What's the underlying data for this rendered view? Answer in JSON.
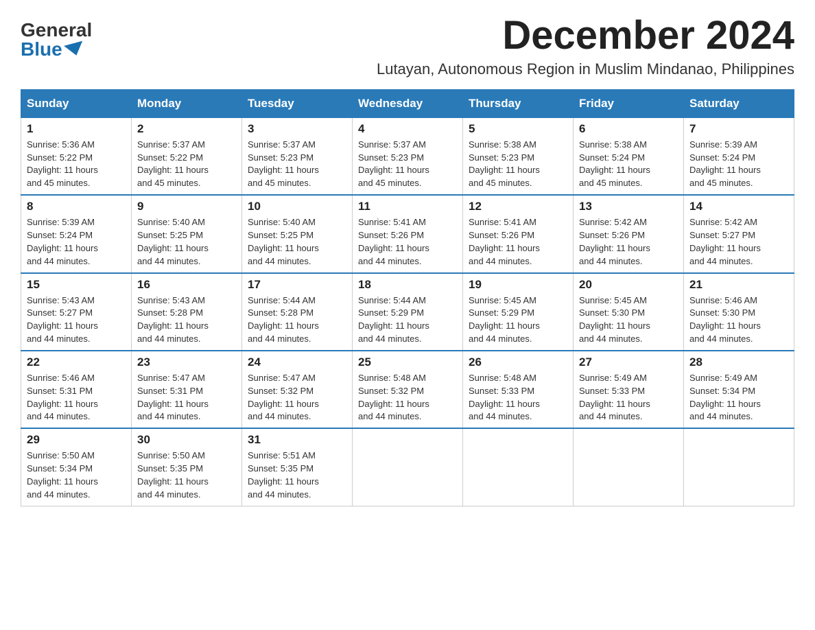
{
  "logo": {
    "general": "General",
    "blue": "Blue"
  },
  "title": "December 2024",
  "subtitle": "Lutayan, Autonomous Region in Muslim Mindanao, Philippines",
  "weekdays": [
    "Sunday",
    "Monday",
    "Tuesday",
    "Wednesday",
    "Thursday",
    "Friday",
    "Saturday"
  ],
  "weeks": [
    [
      {
        "day": "1",
        "sunrise": "5:36 AM",
        "sunset": "5:22 PM",
        "daylight": "11 hours and 45 minutes."
      },
      {
        "day": "2",
        "sunrise": "5:37 AM",
        "sunset": "5:22 PM",
        "daylight": "11 hours and 45 minutes."
      },
      {
        "day": "3",
        "sunrise": "5:37 AM",
        "sunset": "5:23 PM",
        "daylight": "11 hours and 45 minutes."
      },
      {
        "day": "4",
        "sunrise": "5:37 AM",
        "sunset": "5:23 PM",
        "daylight": "11 hours and 45 minutes."
      },
      {
        "day": "5",
        "sunrise": "5:38 AM",
        "sunset": "5:23 PM",
        "daylight": "11 hours and 45 minutes."
      },
      {
        "day": "6",
        "sunrise": "5:38 AM",
        "sunset": "5:24 PM",
        "daylight": "11 hours and 45 minutes."
      },
      {
        "day": "7",
        "sunrise": "5:39 AM",
        "sunset": "5:24 PM",
        "daylight": "11 hours and 45 minutes."
      }
    ],
    [
      {
        "day": "8",
        "sunrise": "5:39 AM",
        "sunset": "5:24 PM",
        "daylight": "11 hours and 44 minutes."
      },
      {
        "day": "9",
        "sunrise": "5:40 AM",
        "sunset": "5:25 PM",
        "daylight": "11 hours and 44 minutes."
      },
      {
        "day": "10",
        "sunrise": "5:40 AM",
        "sunset": "5:25 PM",
        "daylight": "11 hours and 44 minutes."
      },
      {
        "day": "11",
        "sunrise": "5:41 AM",
        "sunset": "5:26 PM",
        "daylight": "11 hours and 44 minutes."
      },
      {
        "day": "12",
        "sunrise": "5:41 AM",
        "sunset": "5:26 PM",
        "daylight": "11 hours and 44 minutes."
      },
      {
        "day": "13",
        "sunrise": "5:42 AM",
        "sunset": "5:26 PM",
        "daylight": "11 hours and 44 minutes."
      },
      {
        "day": "14",
        "sunrise": "5:42 AM",
        "sunset": "5:27 PM",
        "daylight": "11 hours and 44 minutes."
      }
    ],
    [
      {
        "day": "15",
        "sunrise": "5:43 AM",
        "sunset": "5:27 PM",
        "daylight": "11 hours and 44 minutes."
      },
      {
        "day": "16",
        "sunrise": "5:43 AM",
        "sunset": "5:28 PM",
        "daylight": "11 hours and 44 minutes."
      },
      {
        "day": "17",
        "sunrise": "5:44 AM",
        "sunset": "5:28 PM",
        "daylight": "11 hours and 44 minutes."
      },
      {
        "day": "18",
        "sunrise": "5:44 AM",
        "sunset": "5:29 PM",
        "daylight": "11 hours and 44 minutes."
      },
      {
        "day": "19",
        "sunrise": "5:45 AM",
        "sunset": "5:29 PM",
        "daylight": "11 hours and 44 minutes."
      },
      {
        "day": "20",
        "sunrise": "5:45 AM",
        "sunset": "5:30 PM",
        "daylight": "11 hours and 44 minutes."
      },
      {
        "day": "21",
        "sunrise": "5:46 AM",
        "sunset": "5:30 PM",
        "daylight": "11 hours and 44 minutes."
      }
    ],
    [
      {
        "day": "22",
        "sunrise": "5:46 AM",
        "sunset": "5:31 PM",
        "daylight": "11 hours and 44 minutes."
      },
      {
        "day": "23",
        "sunrise": "5:47 AM",
        "sunset": "5:31 PM",
        "daylight": "11 hours and 44 minutes."
      },
      {
        "day": "24",
        "sunrise": "5:47 AM",
        "sunset": "5:32 PM",
        "daylight": "11 hours and 44 minutes."
      },
      {
        "day": "25",
        "sunrise": "5:48 AM",
        "sunset": "5:32 PM",
        "daylight": "11 hours and 44 minutes."
      },
      {
        "day": "26",
        "sunrise": "5:48 AM",
        "sunset": "5:33 PM",
        "daylight": "11 hours and 44 minutes."
      },
      {
        "day": "27",
        "sunrise": "5:49 AM",
        "sunset": "5:33 PM",
        "daylight": "11 hours and 44 minutes."
      },
      {
        "day": "28",
        "sunrise": "5:49 AM",
        "sunset": "5:34 PM",
        "daylight": "11 hours and 44 minutes."
      }
    ],
    [
      {
        "day": "29",
        "sunrise": "5:50 AM",
        "sunset": "5:34 PM",
        "daylight": "11 hours and 44 minutes."
      },
      {
        "day": "30",
        "sunrise": "5:50 AM",
        "sunset": "5:35 PM",
        "daylight": "11 hours and 44 minutes."
      },
      {
        "day": "31",
        "sunrise": "5:51 AM",
        "sunset": "5:35 PM",
        "daylight": "11 hours and 44 minutes."
      },
      null,
      null,
      null,
      null
    ]
  ],
  "labels": {
    "sunrise": "Sunrise:",
    "sunset": "Sunset:",
    "daylight": "Daylight:"
  }
}
